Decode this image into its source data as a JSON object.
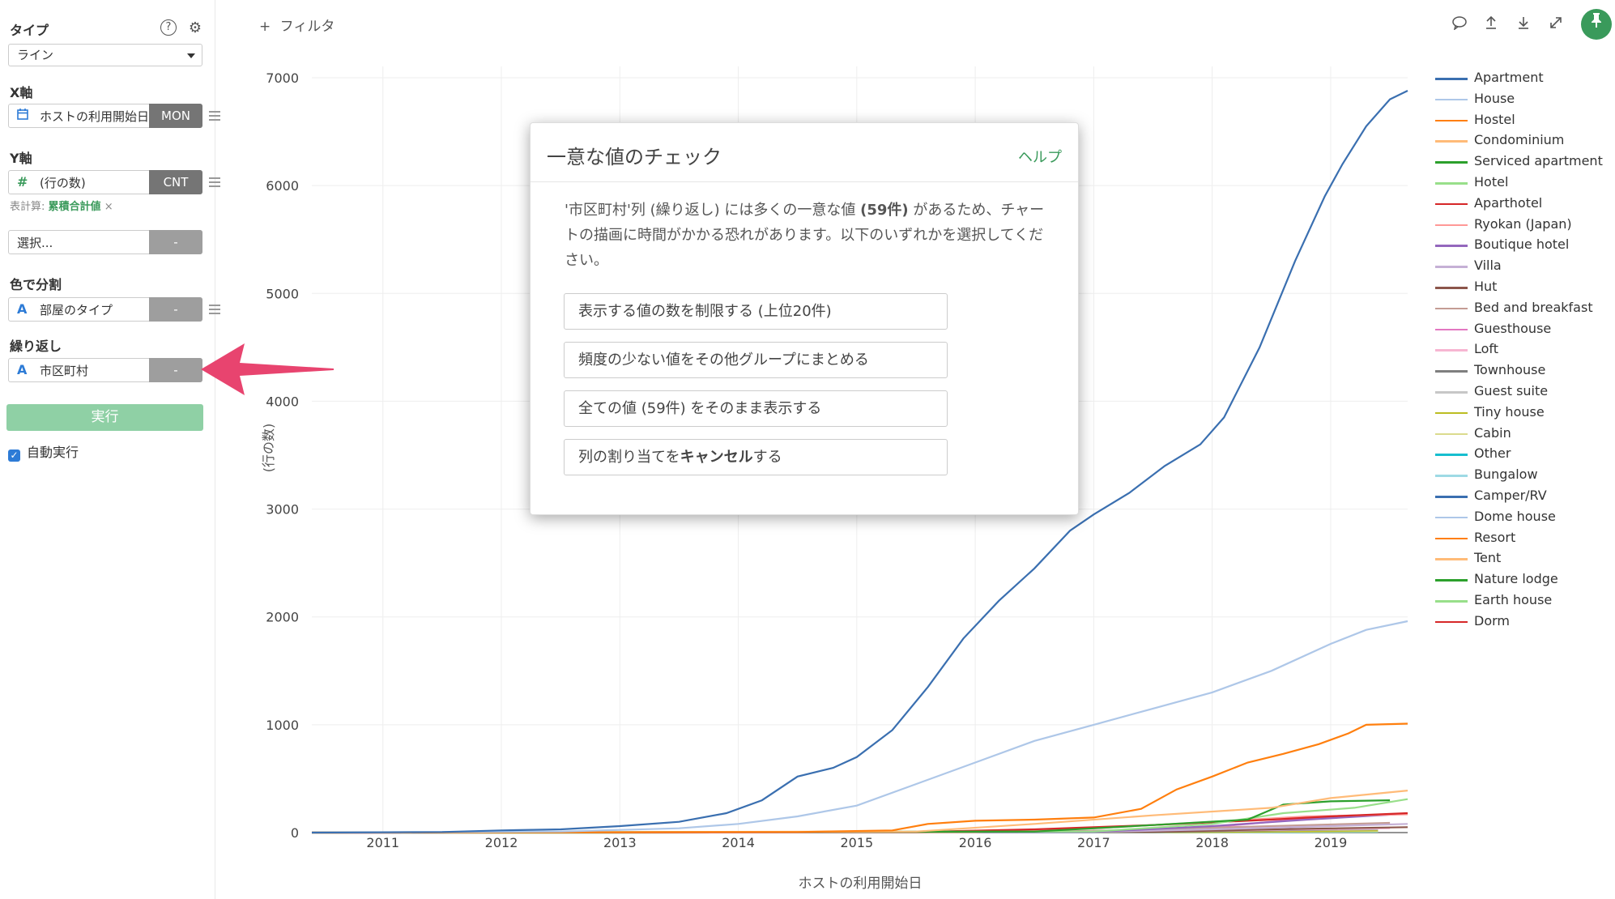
{
  "sidebar": {
    "type_label": "タイプ",
    "type_value": "ライン",
    "xaxis_label": "X軸",
    "xaxis_field": "ホストの利用開始日",
    "xaxis_agg": "MON",
    "yaxis_label": "Y軸",
    "yaxis_field": "(行の数)",
    "yaxis_agg": "CNT",
    "calc_prefix": "表計算:",
    "calc_value": "累積合計値",
    "calc_close": "×",
    "extra_placeholder": "選択...",
    "extra_agg": "-",
    "color_label": "色で分割",
    "color_field": "部屋のタイプ",
    "color_agg": "-",
    "repeat_label": "繰り返し",
    "repeat_field": "市区町村",
    "repeat_agg": "-",
    "run_label": "実行",
    "auto_label": "自動実行",
    "auto_checked": true
  },
  "toolbar": {
    "filter_label": "フィルタ",
    "filter_plus": "+"
  },
  "modal": {
    "title": "一意な値のチェック",
    "help": "ヘルプ",
    "message_pre": "'市区町村'列 (繰り返し) には多くの一意な値 ",
    "message_bold": "(59件)",
    "message_post": " があるため、チャートの描画に時間がかかる恐れがあります。以下のいずれかを選択してください。",
    "option1": "表示する値の数を制限する (上位20件)",
    "option2": "頻度の少ない値をその他グループにまとめる",
    "option3": "全ての値 (59件) をそのまま表示する",
    "option4_pre": "列の割り当てを",
    "option4_bold": "キャンセル",
    "option4_post": "する"
  },
  "colors": {
    "accent_green": "#3a9a5b",
    "run_button": "#8fd0a5",
    "annotation_arrow": "#e8446f"
  },
  "chart_data": {
    "type": "line",
    "xlabel": "ホストの利用開始日",
    "ylabel": "(行の数)",
    "x_ticks": [
      "2011",
      "2012",
      "2013",
      "2014",
      "2015",
      "2016",
      "2017",
      "2018",
      "2019"
    ],
    "y_ticks": [
      0,
      1000,
      2000,
      3000,
      4000,
      5000,
      6000,
      7000
    ],
    "xlim": [
      2010.4,
      2019.65
    ],
    "ylim": [
      0,
      7000
    ],
    "grid": true,
    "legend_position": "right",
    "series": [
      {
        "name": "Apartment",
        "color": "#3a6fb0",
        "points": [
          [
            2010.4,
            0
          ],
          [
            2011.5,
            5
          ],
          [
            2012.0,
            20
          ],
          [
            2012.5,
            30
          ],
          [
            2013.0,
            60
          ],
          [
            2013.5,
            100
          ],
          [
            2013.9,
            180
          ],
          [
            2014.2,
            300
          ],
          [
            2014.5,
            520
          ],
          [
            2014.8,
            600
          ],
          [
            2015.0,
            700
          ],
          [
            2015.3,
            950
          ],
          [
            2015.6,
            1350
          ],
          [
            2015.9,
            1800
          ],
          [
            2016.2,
            2150
          ],
          [
            2016.5,
            2450
          ],
          [
            2016.8,
            2800
          ],
          [
            2017.0,
            2950
          ],
          [
            2017.3,
            3150
          ],
          [
            2017.6,
            3400
          ],
          [
            2017.9,
            3600
          ],
          [
            2018.1,
            3850
          ],
          [
            2018.4,
            4500
          ],
          [
            2018.7,
            5300
          ],
          [
            2018.95,
            5900
          ],
          [
            2019.1,
            6200
          ],
          [
            2019.3,
            6550
          ],
          [
            2019.5,
            6800
          ],
          [
            2019.65,
            6880
          ]
        ]
      },
      {
        "name": "House",
        "color": "#aec7e8",
        "points": [
          [
            2010.4,
            0
          ],
          [
            2012.5,
            10
          ],
          [
            2013.5,
            40
          ],
          [
            2014.0,
            80
          ],
          [
            2014.5,
            150
          ],
          [
            2015.0,
            250
          ],
          [
            2015.5,
            450
          ],
          [
            2016.0,
            650
          ],
          [
            2016.5,
            850
          ],
          [
            2017.0,
            1000
          ],
          [
            2017.5,
            1150
          ],
          [
            2018.0,
            1300
          ],
          [
            2018.5,
            1500
          ],
          [
            2019.0,
            1750
          ],
          [
            2019.3,
            1880
          ],
          [
            2019.65,
            1960
          ]
        ]
      },
      {
        "name": "Hostel",
        "color": "#ff7f0e",
        "points": [
          [
            2010.4,
            0
          ],
          [
            2014.5,
            5
          ],
          [
            2015.3,
            20
          ],
          [
            2015.6,
            80
          ],
          [
            2016.0,
            110
          ],
          [
            2016.5,
            120
          ],
          [
            2017.0,
            140
          ],
          [
            2017.4,
            220
          ],
          [
            2017.7,
            400
          ],
          [
            2018.0,
            520
          ],
          [
            2018.3,
            650
          ],
          [
            2018.6,
            730
          ],
          [
            2018.9,
            820
          ],
          [
            2019.15,
            920
          ],
          [
            2019.3,
            1000
          ],
          [
            2019.65,
            1010
          ]
        ]
      },
      {
        "name": "Condominium",
        "color": "#ffbb78",
        "points": [
          [
            2010.4,
            0
          ],
          [
            2015.5,
            10
          ],
          [
            2016.5,
            80
          ],
          [
            2017.5,
            160
          ],
          [
            2018.5,
            230
          ],
          [
            2019.0,
            320
          ],
          [
            2019.65,
            390
          ]
        ]
      },
      {
        "name": "Serviced apartment",
        "color": "#2ca02c",
        "points": [
          [
            2010.4,
            0
          ],
          [
            2016.5,
            10
          ],
          [
            2017.5,
            70
          ],
          [
            2018.3,
            120
          ],
          [
            2018.6,
            260
          ],
          [
            2019.0,
            290
          ],
          [
            2019.5,
            300
          ]
        ]
      },
      {
        "name": "Hotel",
        "color": "#98df8a",
        "points": [
          [
            2010.4,
            0
          ],
          [
            2017.0,
            10
          ],
          [
            2018.0,
            80
          ],
          [
            2018.6,
            180
          ],
          [
            2019.2,
            230
          ],
          [
            2019.65,
            310
          ]
        ]
      },
      {
        "name": "Aparthotel",
        "color": "#d62728",
        "points": [
          [
            2010.4,
            0
          ],
          [
            2015.5,
            5
          ],
          [
            2016.5,
            30
          ],
          [
            2017.5,
            70
          ],
          [
            2018.5,
            120
          ],
          [
            2019.0,
            150
          ],
          [
            2019.65,
            180
          ]
        ]
      },
      {
        "name": "Ryokan (Japan)",
        "color": "#ff9896",
        "points": [
          [
            2010.4,
            0
          ],
          [
            2016.0,
            5
          ],
          [
            2017.0,
            40
          ],
          [
            2018.0,
            100
          ],
          [
            2018.8,
            150
          ],
          [
            2019.65,
            170
          ]
        ]
      },
      {
        "name": "Boutique hotel",
        "color": "#9467bd",
        "points": [
          [
            2010.4,
            0
          ],
          [
            2017.0,
            5
          ],
          [
            2018.0,
            60
          ],
          [
            2018.8,
            120
          ],
          [
            2019.65,
            175
          ]
        ]
      },
      {
        "name": "Villa",
        "color": "#c5b0d5",
        "points": [
          [
            2010.4,
            0
          ],
          [
            2017.0,
            5
          ],
          [
            2018.0,
            30
          ],
          [
            2019.0,
            60
          ],
          [
            2019.65,
            80
          ]
        ]
      },
      {
        "name": "Hut",
        "color": "#8c564b",
        "points": [
          [
            2010.4,
            0
          ],
          [
            2017.5,
            5
          ],
          [
            2018.5,
            30
          ],
          [
            2019.65,
            50
          ]
        ]
      },
      {
        "name": "Bed and breakfast",
        "color": "#c49c94",
        "points": [
          [
            2010.4,
            0
          ],
          [
            2016.5,
            5
          ],
          [
            2017.5,
            30
          ],
          [
            2018.5,
            60
          ],
          [
            2019.5,
            90
          ]
        ]
      },
      {
        "name": "Guesthouse",
        "color": "#e377c2",
        "points": [
          [
            2010.4,
            0
          ],
          [
            2017.0,
            5
          ],
          [
            2018.0,
            50
          ],
          [
            2018.7,
            120
          ],
          [
            2019.3,
            160
          ]
        ]
      },
      {
        "name": "Loft",
        "color": "#f7b6d2",
        "points": [
          [
            2010.4,
            0
          ],
          [
            2017.0,
            5
          ],
          [
            2018.5,
            25
          ],
          [
            2019.5,
            40
          ]
        ]
      },
      {
        "name": "Townhouse",
        "color": "#7f7f7f",
        "points": [
          [
            2010.4,
            0
          ],
          [
            2017.5,
            5
          ],
          [
            2018.5,
            20
          ],
          [
            2019.4,
            35
          ]
        ]
      },
      {
        "name": "Guest suite",
        "color": "#c7c7c7",
        "points": [
          [
            2010.4,
            0
          ],
          [
            2017.5,
            5
          ],
          [
            2018.5,
            20
          ],
          [
            2019.4,
            30
          ]
        ]
      },
      {
        "name": "Tiny house",
        "color": "#bcbd22",
        "points": [
          [
            2010.4,
            0
          ],
          [
            2018.0,
            5
          ],
          [
            2019.0,
            15
          ],
          [
            2019.4,
            20
          ]
        ]
      },
      {
        "name": "Cabin",
        "color": "#dbdb8d",
        "points": [
          [
            2010.4,
            0
          ],
          [
            2018.0,
            3
          ],
          [
            2019.4,
            12
          ]
        ]
      },
      {
        "name": "Other",
        "color": "#17becf",
        "points": [
          [
            2010.4,
            0
          ],
          [
            2018.0,
            3
          ],
          [
            2019.4,
            10
          ]
        ]
      },
      {
        "name": "Bungalow",
        "color": "#9edae5",
        "points": [
          [
            2010.4,
            0
          ],
          [
            2018.5,
            3
          ],
          [
            2019.4,
            8
          ]
        ]
      },
      {
        "name": "Camper/RV",
        "color": "#3a6fb0",
        "points": [
          [
            2010.4,
            0
          ],
          [
            2018.5,
            2
          ],
          [
            2019.4,
            5
          ]
        ]
      },
      {
        "name": "Dome house",
        "color": "#aec7e8",
        "points": [
          [
            2010.4,
            0
          ],
          [
            2018.5,
            2
          ],
          [
            2019.4,
            4
          ]
        ]
      },
      {
        "name": "Resort",
        "color": "#ff7f0e",
        "points": [
          [
            2010.4,
            0
          ],
          [
            2018.5,
            2
          ],
          [
            2019.4,
            4
          ]
        ]
      },
      {
        "name": "Tent",
        "color": "#ffbb78",
        "points": [
          [
            2010.4,
            0
          ],
          [
            2018.8,
            2
          ],
          [
            2019.4,
            3
          ]
        ]
      },
      {
        "name": "Nature lodge",
        "color": "#2ca02c",
        "points": [
          [
            2010.4,
            0
          ],
          [
            2018.8,
            1
          ],
          [
            2019.4,
            2
          ]
        ]
      },
      {
        "name": "Earth house",
        "color": "#98df8a",
        "points": [
          [
            2010.4,
            0
          ],
          [
            2019.4,
            1
          ]
        ]
      },
      {
        "name": "Dorm",
        "color": "#d62728",
        "points": [
          [
            2010.4,
            0
          ],
          [
            2019.4,
            1
          ]
        ]
      }
    ]
  }
}
